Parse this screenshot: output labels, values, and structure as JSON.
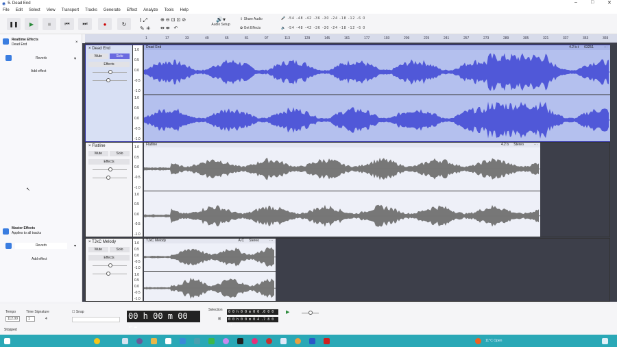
{
  "window": {
    "title": "5. Dead End"
  },
  "menu": [
    "File",
    "Edit",
    "Select",
    "View",
    "Transport",
    "Tracks",
    "Generate",
    "Effect",
    "Analyze",
    "Tools",
    "Help"
  ],
  "toolbar": {
    "audio_setup": "Audio Setup",
    "share_audio": "Share Audio",
    "get_effects": "Get Effects"
  },
  "ruler": [
    "1",
    "17",
    "33",
    "49",
    "65",
    "81",
    "97",
    "113",
    "129",
    "145",
    "161",
    "177",
    "193",
    "209",
    "225",
    "241",
    "257",
    "273",
    "289",
    "305",
    "321",
    "337",
    "353",
    "369"
  ],
  "effects_panel": {
    "title": "Realtime Effects",
    "track": "Dead End",
    "effect": "Reverb",
    "add_effect": "Add effect",
    "master_title": "Master Effects",
    "master_sub": "Applies to all tracks",
    "master_effect": "Reverb",
    "master_add": "Add effect"
  },
  "tracks": [
    {
      "name": "Dead End",
      "clip": "Dead End",
      "mute": "Mute",
      "solo": "Solo",
      "effects": "Effects",
      "speed": "4.2 b.t",
      "rate": "63251",
      "selected": true
    },
    {
      "name": "Flatline",
      "clip": "Flatline",
      "mute": "Mute",
      "solo": "Solo",
      "effects": "Effects",
      "speed": "4.2 b",
      "rate": "Stereo",
      "selected": false
    },
    {
      "name": "TJxC Melody",
      "clip": "TJxC Melody",
      "mute": "Mute",
      "solo": "Solo",
      "effects": "Effects",
      "speed": "A.C",
      "rate": "Stereo",
      "selected": false
    }
  ],
  "scale": [
    "1.0",
    "0.5",
    "0.0",
    "-0.5",
    "-1.0"
  ],
  "bottom": {
    "tempo_label": "Tempo",
    "tempo": "112.00",
    "timesig_label": "Time Signature",
    "timesig_num": "1",
    "timesig_den": "4",
    "snap": "Snap",
    "time": "00 h 00 m 00 s",
    "selection_label": "Selection",
    "sel_start": "0 0 h 0 0 m 0 0 .0 0 0 s",
    "sel_end": "0 0 h 0 0 m 0 4 .7 8 0 s"
  },
  "status": "Stopped",
  "taskbar": {
    "weather": "11°C Open"
  }
}
